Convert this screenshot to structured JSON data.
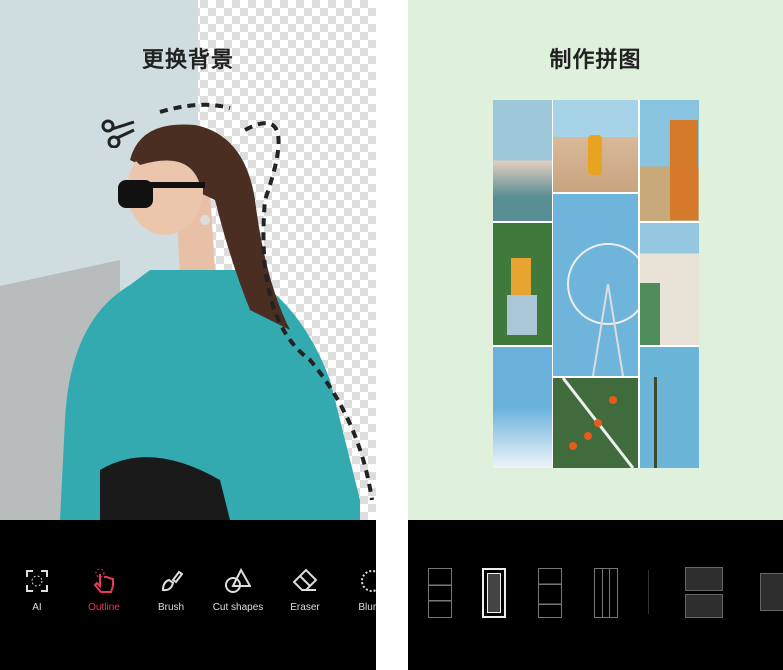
{
  "left": {
    "title": "更换背景",
    "tools": [
      {
        "label": "AI",
        "icon": "ai-select-icon"
      },
      {
        "label": "Outline",
        "icon": "hand-tap-icon",
        "active": true
      },
      {
        "label": "Brush",
        "icon": "brush-icon"
      },
      {
        "label": "Cut shapes",
        "icon": "shapes-icon"
      },
      {
        "label": "Eraser",
        "icon": "eraser-icon"
      },
      {
        "label": "Blur E",
        "icon": "blur-edge-icon"
      }
    ],
    "accent": "#e8385a"
  },
  "right": {
    "title": "制作拼图",
    "selected_layout": 2
  }
}
